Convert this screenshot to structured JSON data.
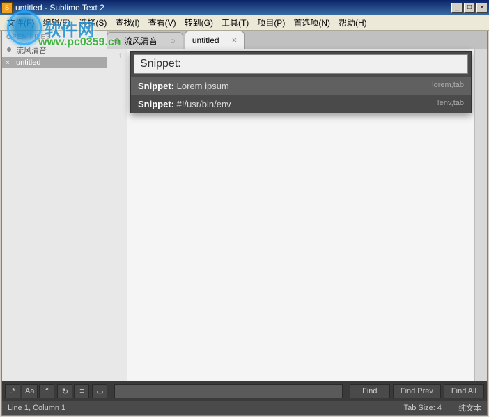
{
  "titlebar": {
    "app_icon": "S",
    "title": "untitled - Sublime Text 2"
  },
  "menu": {
    "file": "文件(F)",
    "edit": "编辑(E)",
    "select": "选择(S)",
    "find": "查找(I)",
    "view": "查看(V)",
    "goto": "转到(G)",
    "tools": "工具(T)",
    "project": "项目(P)",
    "prefs": "首选项(N)",
    "help": "帮助(H)"
  },
  "watermark": {
    "text": "软件网",
    "url": "www.pc0359.cn"
  },
  "sidebar": {
    "section": "OPEN FILES",
    "items": [
      {
        "label": "流风清音",
        "active": false,
        "dirty": true
      },
      {
        "label": "untitled",
        "active": true,
        "dirty": false
      }
    ]
  },
  "tabs": [
    {
      "label": "流风清音",
      "active": false,
      "dirty": true
    },
    {
      "label": "untitled",
      "active": true,
      "dirty": false
    }
  ],
  "gutter": {
    "line1": "1"
  },
  "palette": {
    "query": "Snippet:",
    "items": [
      {
        "prefix": "Snippet:",
        "text": " Lorem ipsum",
        "hint": "lorem,tab",
        "selected": true
      },
      {
        "prefix": "Snippet:",
        "text": " #!/usr/bin/env",
        "hint": "!env,tab",
        "selected": false
      }
    ]
  },
  "findbar": {
    "btn_regex": ".*",
    "btn_case": "Aa",
    "btn_word": "“”",
    "btn_wrap": "↻",
    "btn_sel": "≡",
    "btn_hl": "▭",
    "input_value": "",
    "btn_find": "Find",
    "btn_prev": "Find Prev",
    "btn_all": "Find All"
  },
  "status": {
    "pos": "Line 1, Column 1",
    "tab": "Tab Size: 4",
    "syntax": "纯文本"
  }
}
